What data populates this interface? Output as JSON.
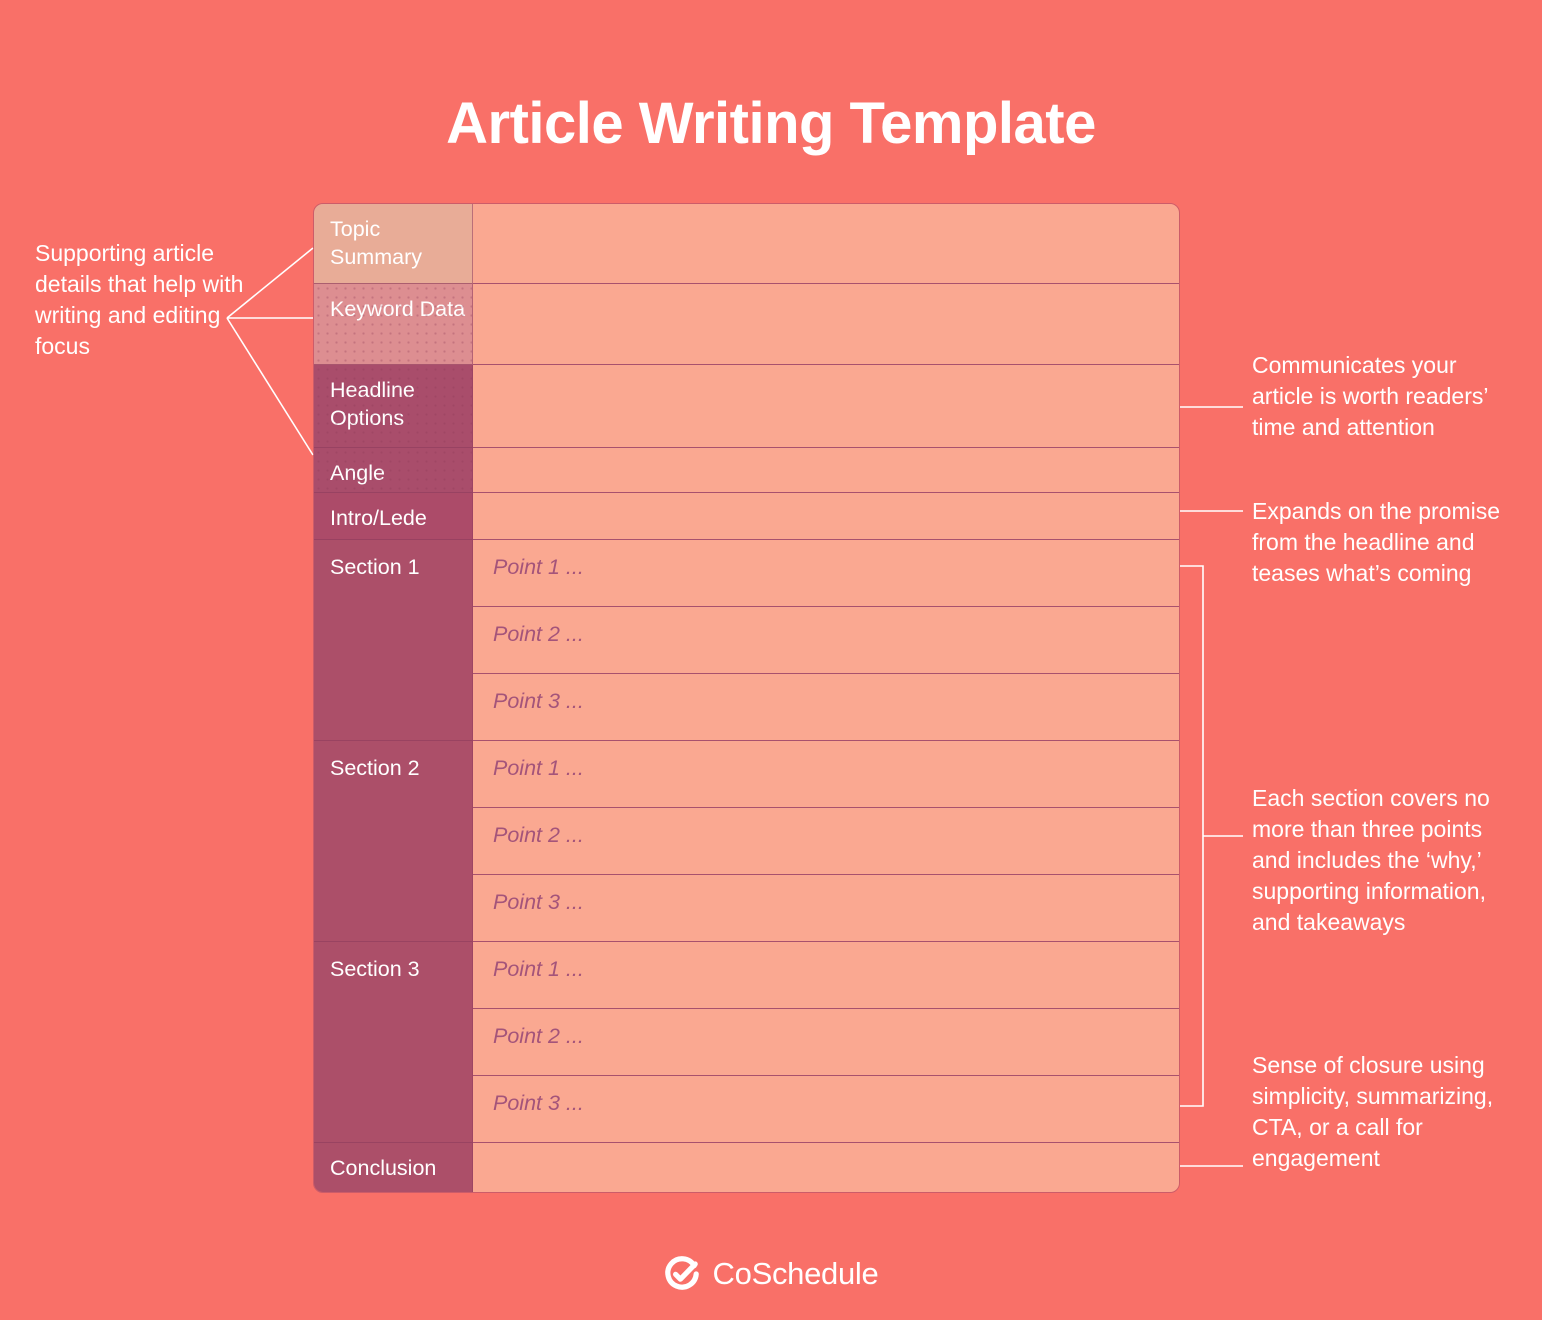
{
  "page": {
    "title": "Article Writing Template",
    "background_color": "#F97068"
  },
  "colors": {
    "background": "#F97068",
    "value_cell": "#FAA891",
    "label_topic_summary": "#E8AC97",
    "label_keyword_data": "#DD8E91",
    "label_headline_options": "#A94D6B",
    "label_angle": "#A94D6B",
    "label_intro_lede": "#AC4B69",
    "label_section": "#AC4F69",
    "point_text": "#A4547A",
    "text_white": "#FFFFFF",
    "border": "#A8516D"
  },
  "table": {
    "rows": [
      {
        "label": "Topic Summary",
        "value": ""
      },
      {
        "label": "Keyword Data",
        "value": ""
      },
      {
        "label": "Headline Options",
        "value": ""
      },
      {
        "label": "Angle",
        "value": ""
      },
      {
        "label": "Intro/Lede",
        "value": ""
      }
    ],
    "sections": [
      {
        "label": "Section 1",
        "points": [
          "Point 1 ...",
          "Point 2 ...",
          "Point 3 ..."
        ]
      },
      {
        "label": "Section 2",
        "points": [
          "Point 1 ...",
          "Point 2 ...",
          "Point 3 ..."
        ]
      },
      {
        "label": "Section 3",
        "points": [
          "Point 1 ...",
          "Point 2 ...",
          "Point 3 ..."
        ]
      }
    ],
    "conclusion": {
      "label": "Conclusion",
      "value": ""
    }
  },
  "annotations": {
    "left": "Supporting article details that help with writing and editing focus",
    "right_headline": "Communicates your article is worth readers’ time and attention",
    "right_intro": "Expands on the promise from the headline and teases what’s coming",
    "right_sections": "Each section covers no more than three points and includes the ‘why,’ supporting information, and takeaways",
    "right_conclusion": "Sense of closure using simplicity, summarizing, CTA, or a call for engagement"
  },
  "footer": {
    "brand": "CoSchedule",
    "logo_icon": "coschedule-check-circle-icon"
  }
}
